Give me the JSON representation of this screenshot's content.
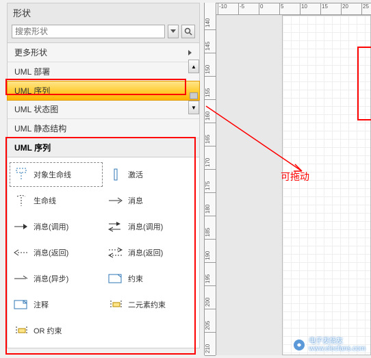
{
  "panel": {
    "title": "形状",
    "search_placeholder": "搜索形状"
  },
  "stencils": {
    "more": "更多形状",
    "items": [
      "UML 部署",
      "UML 序列",
      "UML 状态图",
      "UML 静态结构"
    ],
    "selected_index": 1
  },
  "section": {
    "header": "UML 序列"
  },
  "shapes": [
    {
      "label": "对象生命线",
      "icon": "lifeline-object"
    },
    {
      "label": "激活",
      "icon": "activation"
    },
    {
      "label": "生命线",
      "icon": "lifeline"
    },
    {
      "label": "消息",
      "icon": "message-arrow"
    },
    {
      "label": "消息(调用)",
      "icon": "message-call"
    },
    {
      "label": "消息(调用)",
      "icon": "message-call-self"
    },
    {
      "label": "消息(返回)",
      "icon": "message-return"
    },
    {
      "label": "消息(返回)",
      "icon": "message-return-self"
    },
    {
      "label": "消息(异步)",
      "icon": "message-async"
    },
    {
      "label": "约束",
      "icon": "constraint"
    },
    {
      "label": "注释",
      "icon": "note"
    },
    {
      "label": "二元素约束",
      "icon": "binary-constraint"
    },
    {
      "label": "OR 约束",
      "icon": "or-constraint"
    }
  ],
  "annotation": {
    "drag_label": "可拖动"
  },
  "ruler": {
    "v_ticks": [
      "140",
      "145",
      "150",
      "155",
      "160",
      "165",
      "170",
      "175",
      "180",
      "185",
      "190",
      "195",
      "200",
      "205",
      "210"
    ],
    "h_ticks": [
      "-10",
      "-5",
      "0",
      "5",
      "10",
      "15",
      "20",
      "25"
    ]
  },
  "watermark": {
    "name": "电子发烧友",
    "url": "www.elecfans.com"
  }
}
